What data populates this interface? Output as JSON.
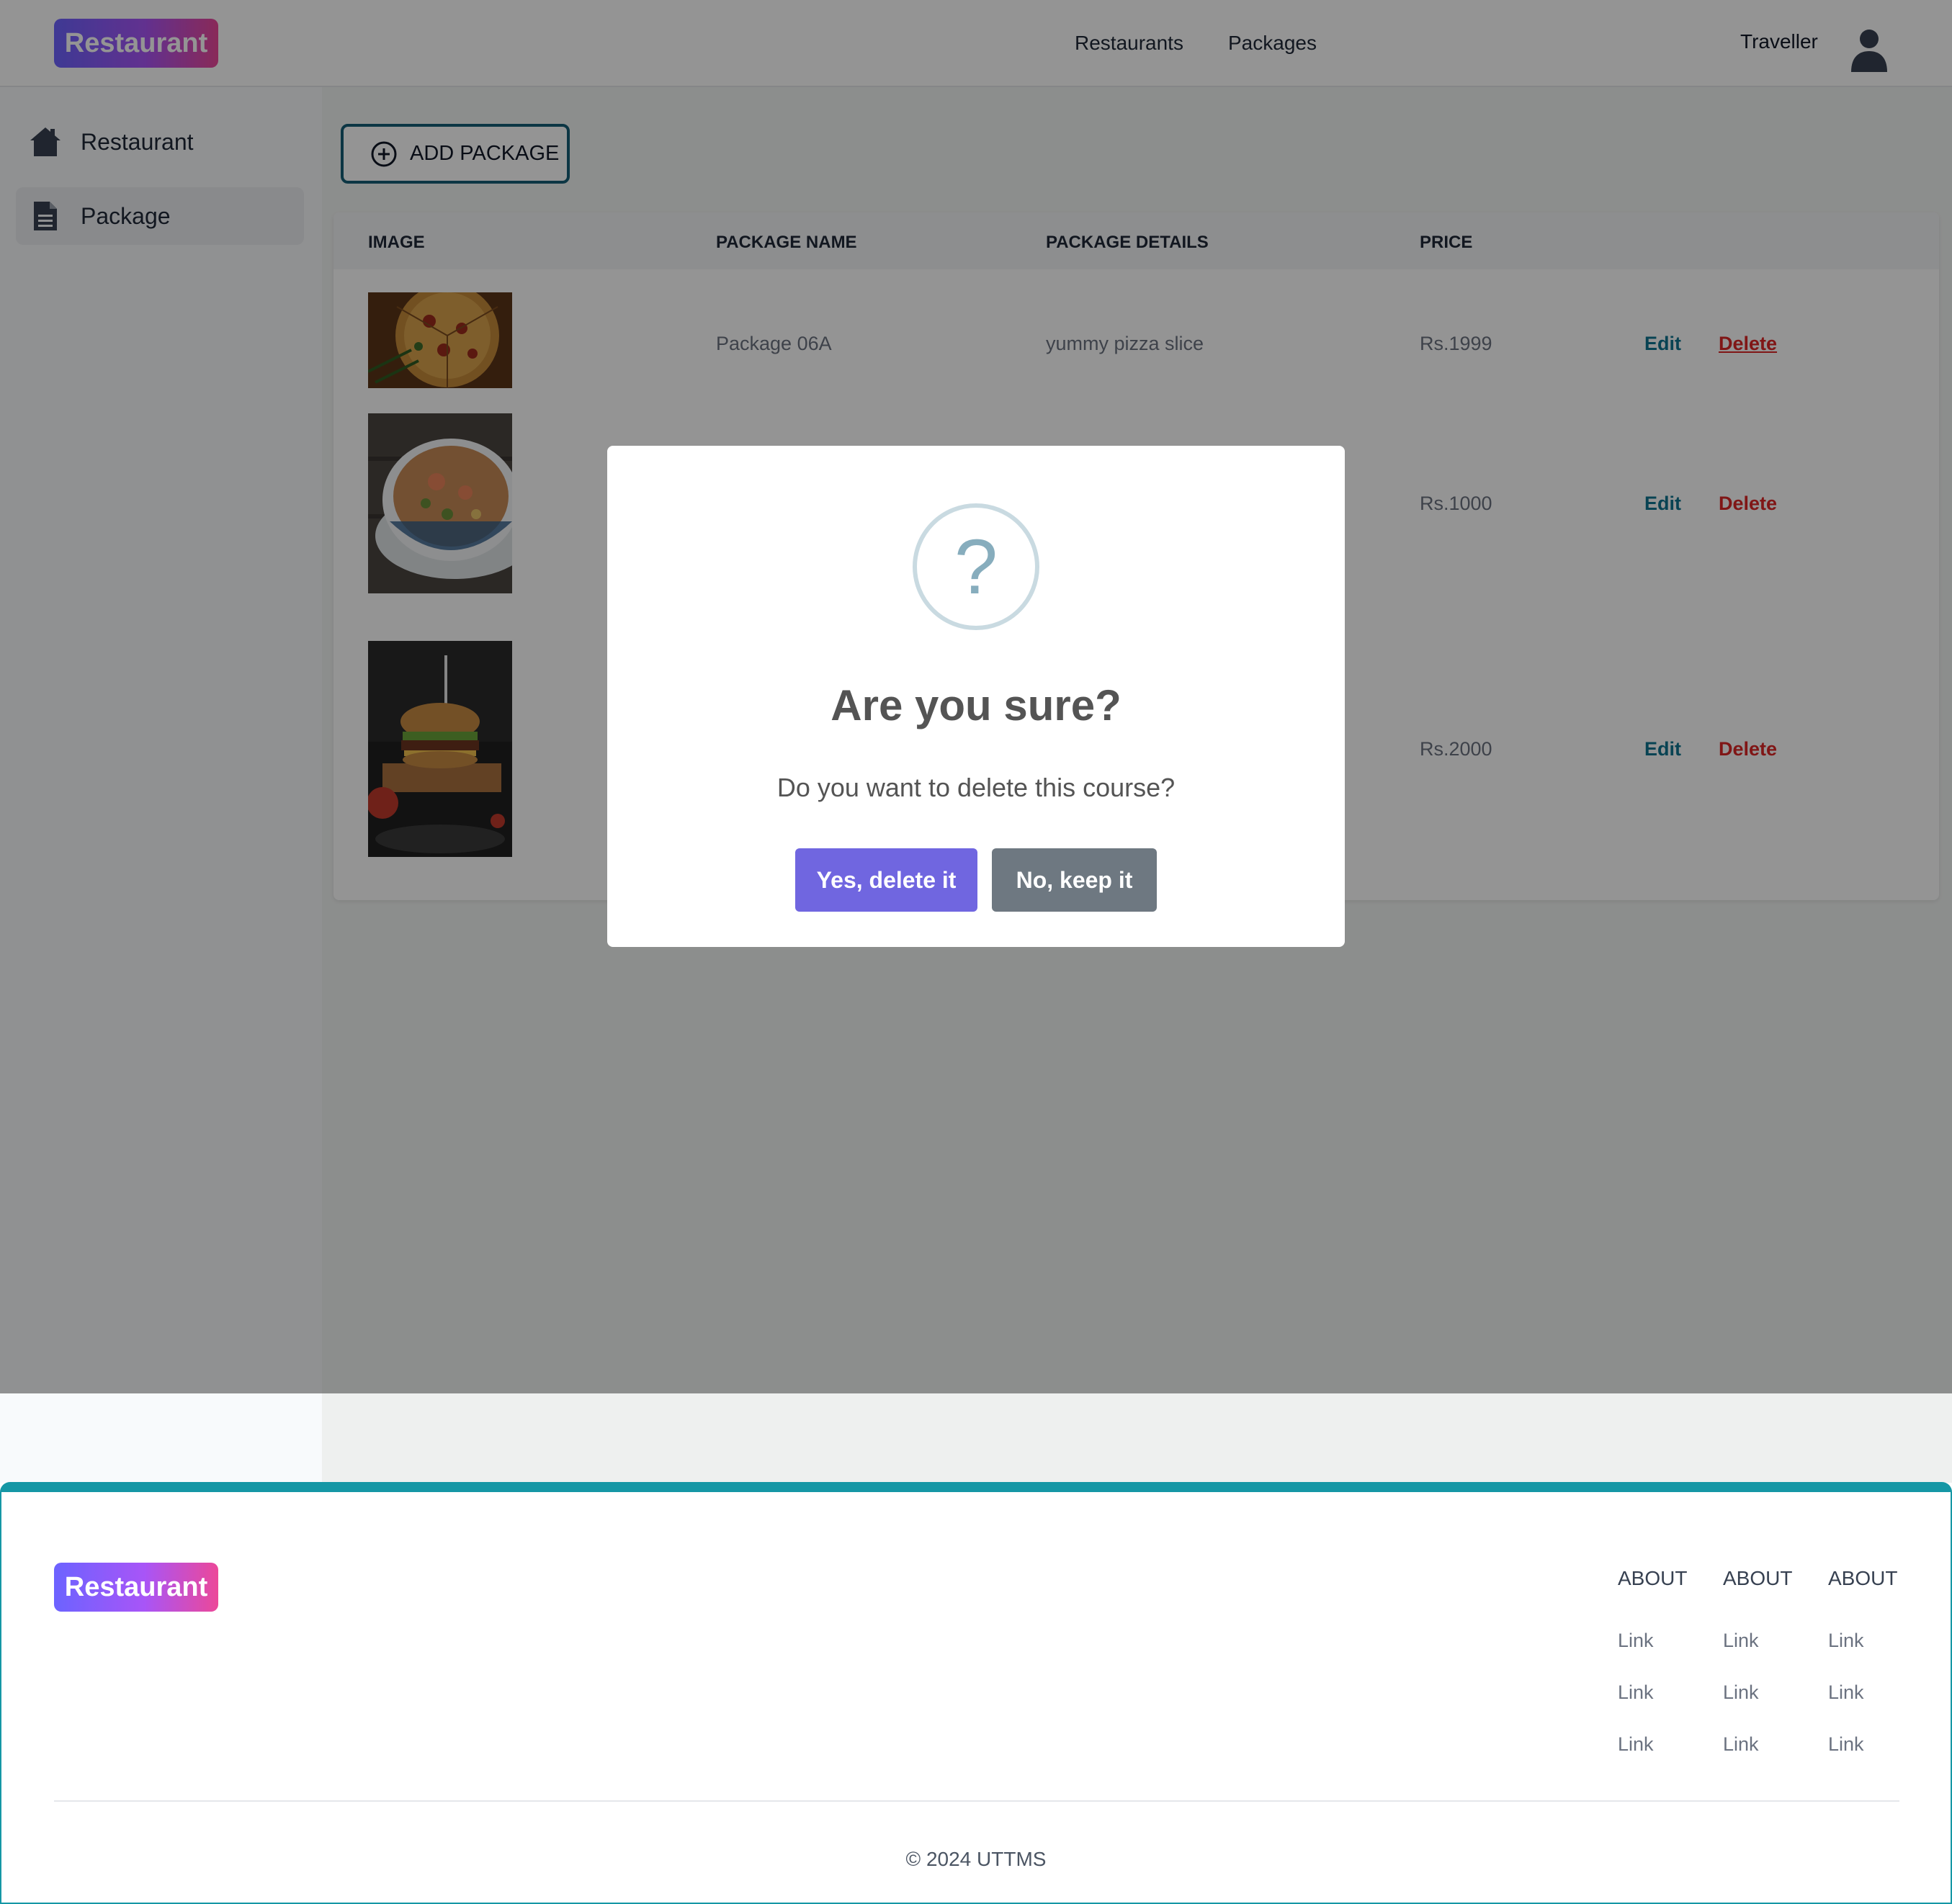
{
  "brand": {
    "logo_text": "Restaurant",
    "gradient": [
      "#6c63ff",
      "#ec4899"
    ]
  },
  "header": {
    "nav": [
      {
        "label": "Restaurants"
      },
      {
        "label": "Packages"
      }
    ],
    "user": {
      "name": "Traveller",
      "icon": "user-avatar-icon"
    }
  },
  "sidebar": {
    "items": [
      {
        "label": "Restaurant",
        "icon": "home-icon",
        "active": false
      },
      {
        "label": "Package",
        "icon": "document-icon",
        "active": true
      }
    ]
  },
  "main": {
    "add_button": {
      "label": "ADD PACKAGE",
      "icon": "plus-circle-icon"
    },
    "table": {
      "headers": [
        "IMAGE",
        "PACKAGE NAME",
        "PACKAGE DETAILS",
        "PRICE"
      ],
      "rows": [
        {
          "image": "pizza",
          "name": "Package 06A",
          "details": "yummy pizza slice",
          "price": "Rs.1999",
          "edit": "Edit",
          "delete": "Delete"
        },
        {
          "image": "soup",
          "name": "",
          "details": "",
          "price": "Rs.1000",
          "edit": "Edit",
          "delete": "Delete"
        },
        {
          "image": "burger",
          "name": "",
          "details": "",
          "price": "Rs.2000",
          "edit": "Edit",
          "delete": "Delete"
        }
      ]
    }
  },
  "dialog": {
    "icon": "?",
    "title": "Are you sure?",
    "text": "Do you want to delete this course?",
    "confirm_label": "Yes, delete it",
    "cancel_label": "No, keep it",
    "confirm_color": "#7066e0",
    "cancel_color": "#6e7881"
  },
  "footer": {
    "logo_text": "Restaurant",
    "columns": [
      {
        "heading": "ABOUT",
        "links": [
          "Link",
          "Link",
          "Link"
        ]
      },
      {
        "heading": "ABOUT",
        "links": [
          "Link",
          "Link",
          "Link"
        ]
      },
      {
        "heading": "ABOUT",
        "links": [
          "Link",
          "Link",
          "Link"
        ]
      }
    ],
    "copyright": "© 2024 UTTMS",
    "accent": "#1597a5"
  }
}
